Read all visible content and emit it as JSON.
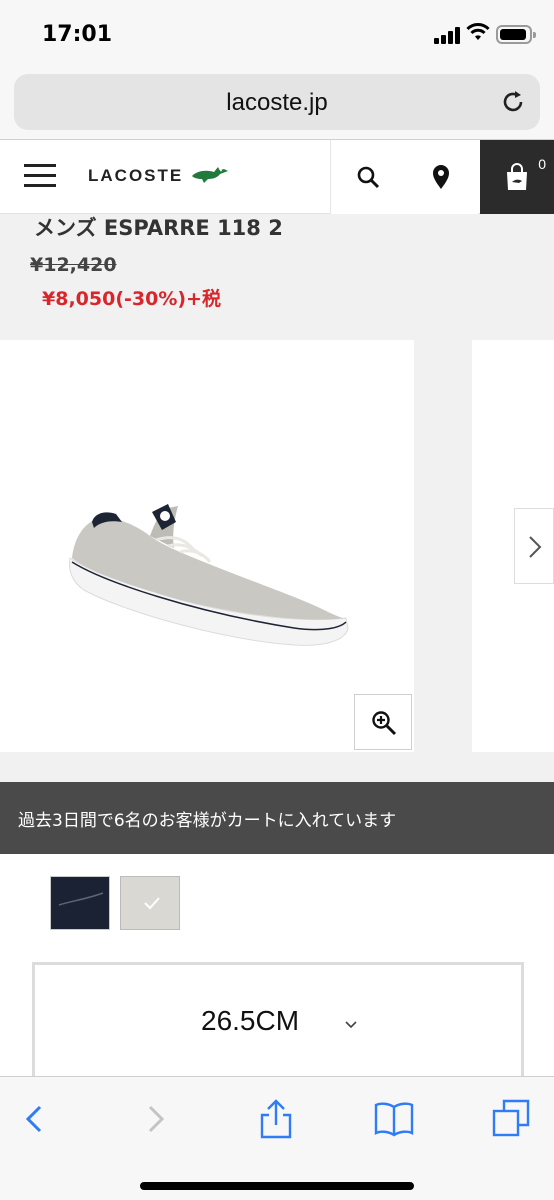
{
  "status_bar": {
    "time": "17:01"
  },
  "browser": {
    "url": "lacoste.jp"
  },
  "site_header": {
    "brand": "LACOSTE",
    "cart_count": "0"
  },
  "product": {
    "title": "メンズ ESPARRE 118 2",
    "original_price": "¥12,420",
    "sale_price": "¥8,050(-30%)+税"
  },
  "banner": {
    "text": "過去3日間で6名のお客様がカートに入れています"
  },
  "size_selector": {
    "selected": "26.5CM"
  },
  "colors": {
    "accent_red": "#d8262b",
    "banner_bg": "#4a4a4a",
    "ios_blue": "#2f7cf6"
  },
  "icons": [
    "menu-icon",
    "crocodile-logo-icon",
    "search-icon",
    "location-pin-icon",
    "shopping-bag-icon",
    "chevron-right-icon",
    "zoom-in-icon",
    "back-icon",
    "forward-icon",
    "share-icon",
    "bookmarks-icon",
    "tabs-icon",
    "reload-icon"
  ]
}
